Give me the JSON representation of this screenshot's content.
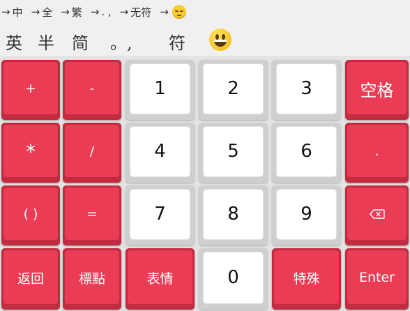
{
  "hints": [
    {
      "arrow": "→",
      "text": "中"
    },
    {
      "arrow": "→",
      "text": "全"
    },
    {
      "arrow": "→",
      "text": "繁"
    },
    {
      "arrow": "→",
      "text": ". ,"
    },
    {
      "arrow": "→",
      "text": "无符"
    },
    {
      "arrow": "→",
      "text": "",
      "icon": "unamused-face-icon"
    }
  ],
  "modes": {
    "lang": "英",
    "width": "半",
    "script": "简",
    "punct": "。,",
    "symbol": "符",
    "emoji_icon": "grinning-face-icon"
  },
  "keys": {
    "plus": "+",
    "minus": "-",
    "one": "1",
    "two": "2",
    "three": "3",
    "space": "空格",
    "multiply": "*",
    "divide": "/",
    "four": "4",
    "five": "5",
    "six": "6",
    "dot": ".",
    "parens": "( )",
    "equals": "=",
    "seven": "7",
    "eight": "8",
    "nine": "9",
    "backspace_icon": "backspace-icon",
    "back": "返回",
    "punctuation": "標點",
    "emoji": "表情",
    "zero": "0",
    "special": "特殊",
    "enter": "Enter"
  },
  "colors": {
    "accent": "#ea3c54",
    "accent_dark": "#c32b40",
    "digit_key": "#ffffff",
    "background": "#e4e4e4"
  }
}
